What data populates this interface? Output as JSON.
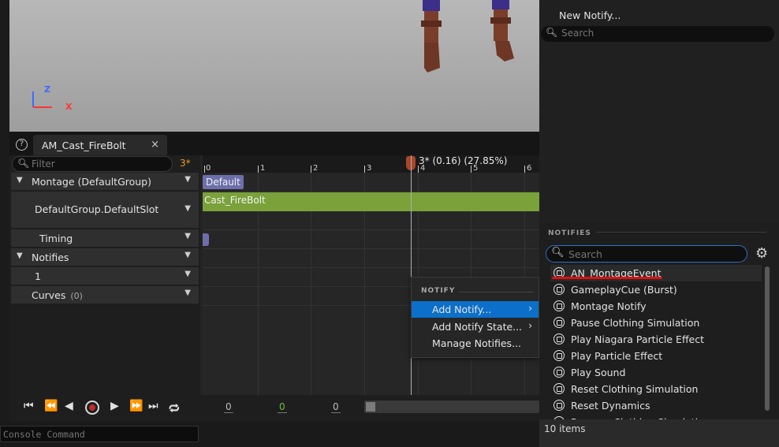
{
  "viewport": {
    "axis_z": "Z",
    "axis_x": "X"
  },
  "tab": {
    "title": "AM_Cast_FireBolt",
    "close": "×",
    "help": "?"
  },
  "tree": {
    "filter_placeholder": "Filter",
    "frame_badge": "3*",
    "rows": [
      {
        "label": "Montage (DefaultGroup)"
      },
      {
        "label": "DefaultGroup.DefaultSlot"
      },
      {
        "label": "Timing"
      },
      {
        "label": "Notifies"
      },
      {
        "label": "1"
      },
      {
        "label": "Curves",
        "count": "(0)"
      }
    ]
  },
  "timeline": {
    "ticks": [
      "0",
      "1",
      "2",
      "3",
      "4",
      "5",
      "6"
    ],
    "playhead_label": "3* (0.16) (27.85%)",
    "default_chip": "Default",
    "slot_clip": "Cast_FireBolt"
  },
  "transport": {
    "num1": "0",
    "num2": "0",
    "num3": "0"
  },
  "context_menu": {
    "header": "NOTIFY",
    "items": [
      {
        "label": "Add Notify...",
        "submenu": true
      },
      {
        "label": "Add Notify State...",
        "submenu": true
      },
      {
        "label": "Manage Notifies...",
        "submenu": false
      }
    ]
  },
  "skeleton_panel": {
    "new_notify": "New Notify...",
    "search_placeholder": "Search"
  },
  "notifies_panel": {
    "header": "NOTIFIES",
    "search_placeholder": "Search",
    "items": [
      "AN_MontageEvent",
      "GameplayCue (Burst)",
      "Montage Notify",
      "Pause Clothing Simulation",
      "Play Niagara Particle Effect",
      "Play Particle Effect",
      "Play Sound",
      "Reset Clothing Simulation",
      "Reset Dynamics",
      "Resume Clothing Simulation"
    ],
    "count_label": "10 items"
  },
  "console": {
    "placeholder": "Console Command"
  },
  "colors": {
    "accent": "#0c6fc9",
    "slot": "#7aa13a",
    "default_chip": "#6d6fab",
    "playhead": "#a8472a"
  }
}
